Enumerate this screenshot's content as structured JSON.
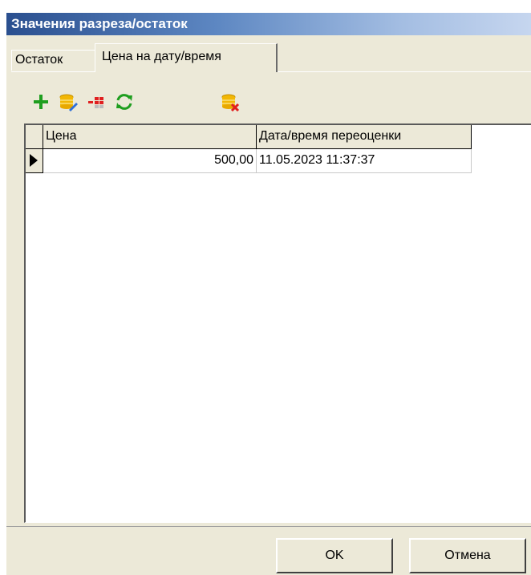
{
  "window": {
    "title": "Значения разреза/остаток"
  },
  "tabs": [
    {
      "label": "Остаток",
      "active": false
    },
    {
      "label": "Цена на дату/время",
      "active": true
    }
  ],
  "toolbar": {
    "icons": [
      "add-icon",
      "edit-record-icon",
      "delete-row-icon",
      "refresh-icon",
      "delete-record-icon"
    ]
  },
  "grid": {
    "columns": [
      "Цена",
      "Дата/время переоценки"
    ],
    "rows": [
      {
        "price": "500,00",
        "datetime": "11.05.2023 11:37:37",
        "current": true
      }
    ]
  },
  "buttons": {
    "ok": "OK",
    "cancel": "Отмена"
  },
  "colors": {
    "title_bar_start": "#2a4f8f",
    "title_bar_end": "#c6d6ef",
    "add_green": "#1f9e1f",
    "db_yellow": "#f2b705",
    "delete_red": "#e02020"
  }
}
